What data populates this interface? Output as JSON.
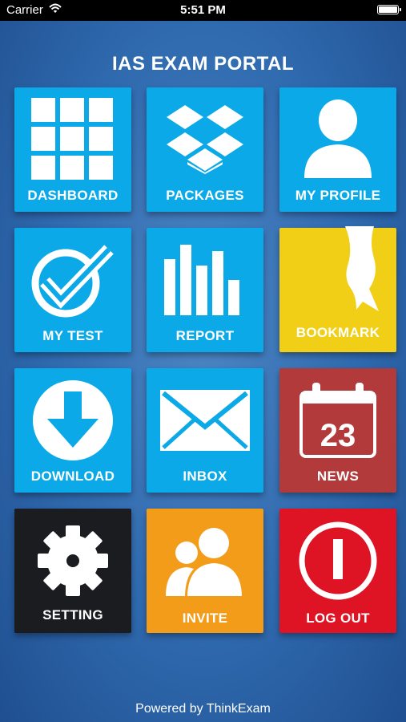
{
  "status_bar": {
    "carrier": "Carrier",
    "time": "5:51 PM"
  },
  "header": {
    "title": "IAS EXAM PORTAL"
  },
  "tiles": [
    {
      "label": "DASHBOARD",
      "color": "#0ba9e8",
      "icon": "grid-icon"
    },
    {
      "label": "PACKAGES",
      "color": "#0ba9e8",
      "icon": "dropbox-icon"
    },
    {
      "label": "MY PROFILE",
      "color": "#0ba9e8",
      "icon": "user-icon"
    },
    {
      "label": "MY TEST",
      "color": "#0ba9e8",
      "icon": "check-circle-icon"
    },
    {
      "label": "REPORT",
      "color": "#0ba9e8",
      "icon": "bar-chart-icon"
    },
    {
      "label": "BOOKMARK",
      "color": "#f2cf17",
      "icon": "bookmark-ribbon-icon"
    },
    {
      "label": "DOWNLOAD",
      "color": "#0ba9e8",
      "icon": "download-icon"
    },
    {
      "label": "INBOX",
      "color": "#0ba9e8",
      "icon": "envelope-icon"
    },
    {
      "label": "NEWS",
      "color": "#b23a3b",
      "icon": "calendar-icon",
      "calendar_day": "23"
    },
    {
      "label": "SETTING",
      "color": "#1a1c1f",
      "icon": "gear-icon"
    },
    {
      "label": "INVITE",
      "color": "#f29c1a",
      "icon": "users-icon"
    },
    {
      "label": "LOG OUT",
      "color": "#de1425",
      "icon": "power-icon"
    }
  ],
  "footer": {
    "text": "Powered by ThinkExam"
  }
}
